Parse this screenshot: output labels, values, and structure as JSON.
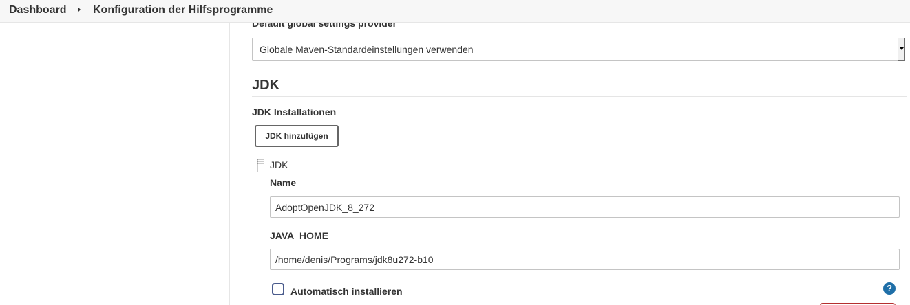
{
  "breadcrumb": {
    "items": [
      "Dashboard",
      "Konfiguration der Hilfsprogramme"
    ]
  },
  "maven_settings": {
    "label": "Default global settings provider",
    "selected": "Globale Maven-Standardeinstellungen verwenden"
  },
  "jdk_section": {
    "title": "JDK",
    "installations_label": "JDK Installationen",
    "add_button": "JDK hinzufügen",
    "installation": {
      "title": "JDK",
      "name_label": "Name",
      "name_value": "AdoptOpenJDK_8_272",
      "home_label": "JAVA_HOME",
      "home_value": "/home/denis/Programs/jdk8u272-b10",
      "auto_install_label": "Automatisch installieren",
      "auto_install_checked": false,
      "help_symbol": "?"
    }
  },
  "icons": {
    "breadcrumb_separator": "chevron-right-icon",
    "drag": "drag-handle-icon",
    "help": "help-icon"
  },
  "colors": {
    "help_icon": "#1f6fa8",
    "checkbox_border": "#4a5b8c",
    "danger_button": "#b52f2f"
  }
}
